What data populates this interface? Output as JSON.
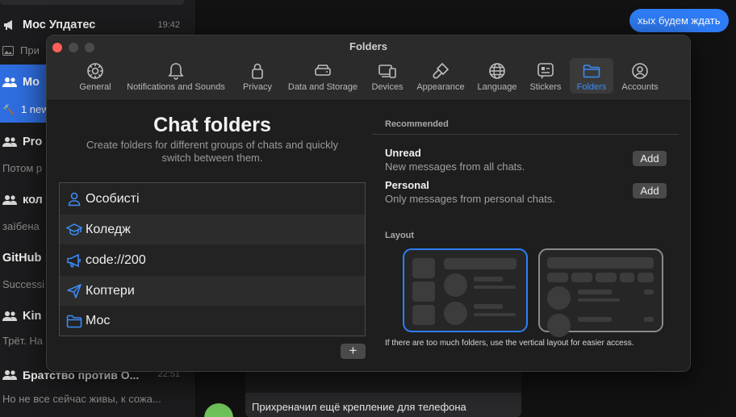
{
  "background_app": {
    "chats": [
      {
        "name": "Мос Упдатес",
        "time": "19:42",
        "preview": "При",
        "active": false
      },
      {
        "name": "Мо",
        "time": "",
        "preview": "1 new",
        "active": true
      },
      {
        "name": "Pro",
        "time": "",
        "preview": "Потом р",
        "active": false
      },
      {
        "name": "кол",
        "time": "",
        "preview": "заїбена",
        "active": false
      },
      {
        "name": "GitHub",
        "time": "",
        "preview": "Successi",
        "active": false
      },
      {
        "name": "Kin",
        "time": "",
        "preview": "Трёт. На",
        "active": false
      },
      {
        "name": "Братство против О...",
        "time": "22:51",
        "preview": "Но не все сейчас живы, к сожа...",
        "active": false
      }
    ],
    "outgoing_message": "хых будем ждать",
    "bottom_message": "Прихреначил ещё крепление для телефона"
  },
  "window": {
    "title": "Folders",
    "tabs": [
      {
        "label": "General",
        "icon": "gear-icon",
        "selected": false
      },
      {
        "label": "Notifications and Sounds",
        "icon": "bell-icon",
        "selected": false
      },
      {
        "label": "Privacy",
        "icon": "lock-icon",
        "selected": false
      },
      {
        "label": "Data and Storage",
        "icon": "drive-icon",
        "selected": false
      },
      {
        "label": "Devices",
        "icon": "devices-icon",
        "selected": false
      },
      {
        "label": "Appearance",
        "icon": "brush-icon",
        "selected": false
      },
      {
        "label": "Language",
        "icon": "globe-icon",
        "selected": false
      },
      {
        "label": "Stickers",
        "icon": "sticker-icon",
        "selected": false
      },
      {
        "label": "Folders",
        "icon": "folder-icon",
        "selected": true
      },
      {
        "label": "Accounts",
        "icon": "account-icon",
        "selected": false
      }
    ],
    "chat_folders": {
      "title": "Chat folders",
      "subtitle": "Create folders for different groups of chats and quickly switch between them.",
      "folders": [
        {
          "name": "Особисті",
          "icon": "person-icon"
        },
        {
          "name": "Коледж",
          "icon": "graduation-cap-icon"
        },
        {
          "name": "code://200",
          "icon": "megaphone-icon"
        },
        {
          "name": "Коптери",
          "icon": "paper-plane-icon"
        },
        {
          "name": "Мос",
          "icon": "folder-icon"
        }
      ],
      "add_label": "+"
    },
    "recommended": {
      "header": "Recommended",
      "items": [
        {
          "title": "Unread",
          "desc": "New messages from all chats.",
          "button": "Add"
        },
        {
          "title": "Personal",
          "desc": "Only messages from personal chats.",
          "button": "Add"
        }
      ]
    },
    "layout": {
      "header": "Layout",
      "selected": "vertical",
      "note": "If there are too much folders, use the vertical layout for easier access."
    },
    "accent_color": "#2f7df6",
    "close_color": "#fe5f57"
  }
}
